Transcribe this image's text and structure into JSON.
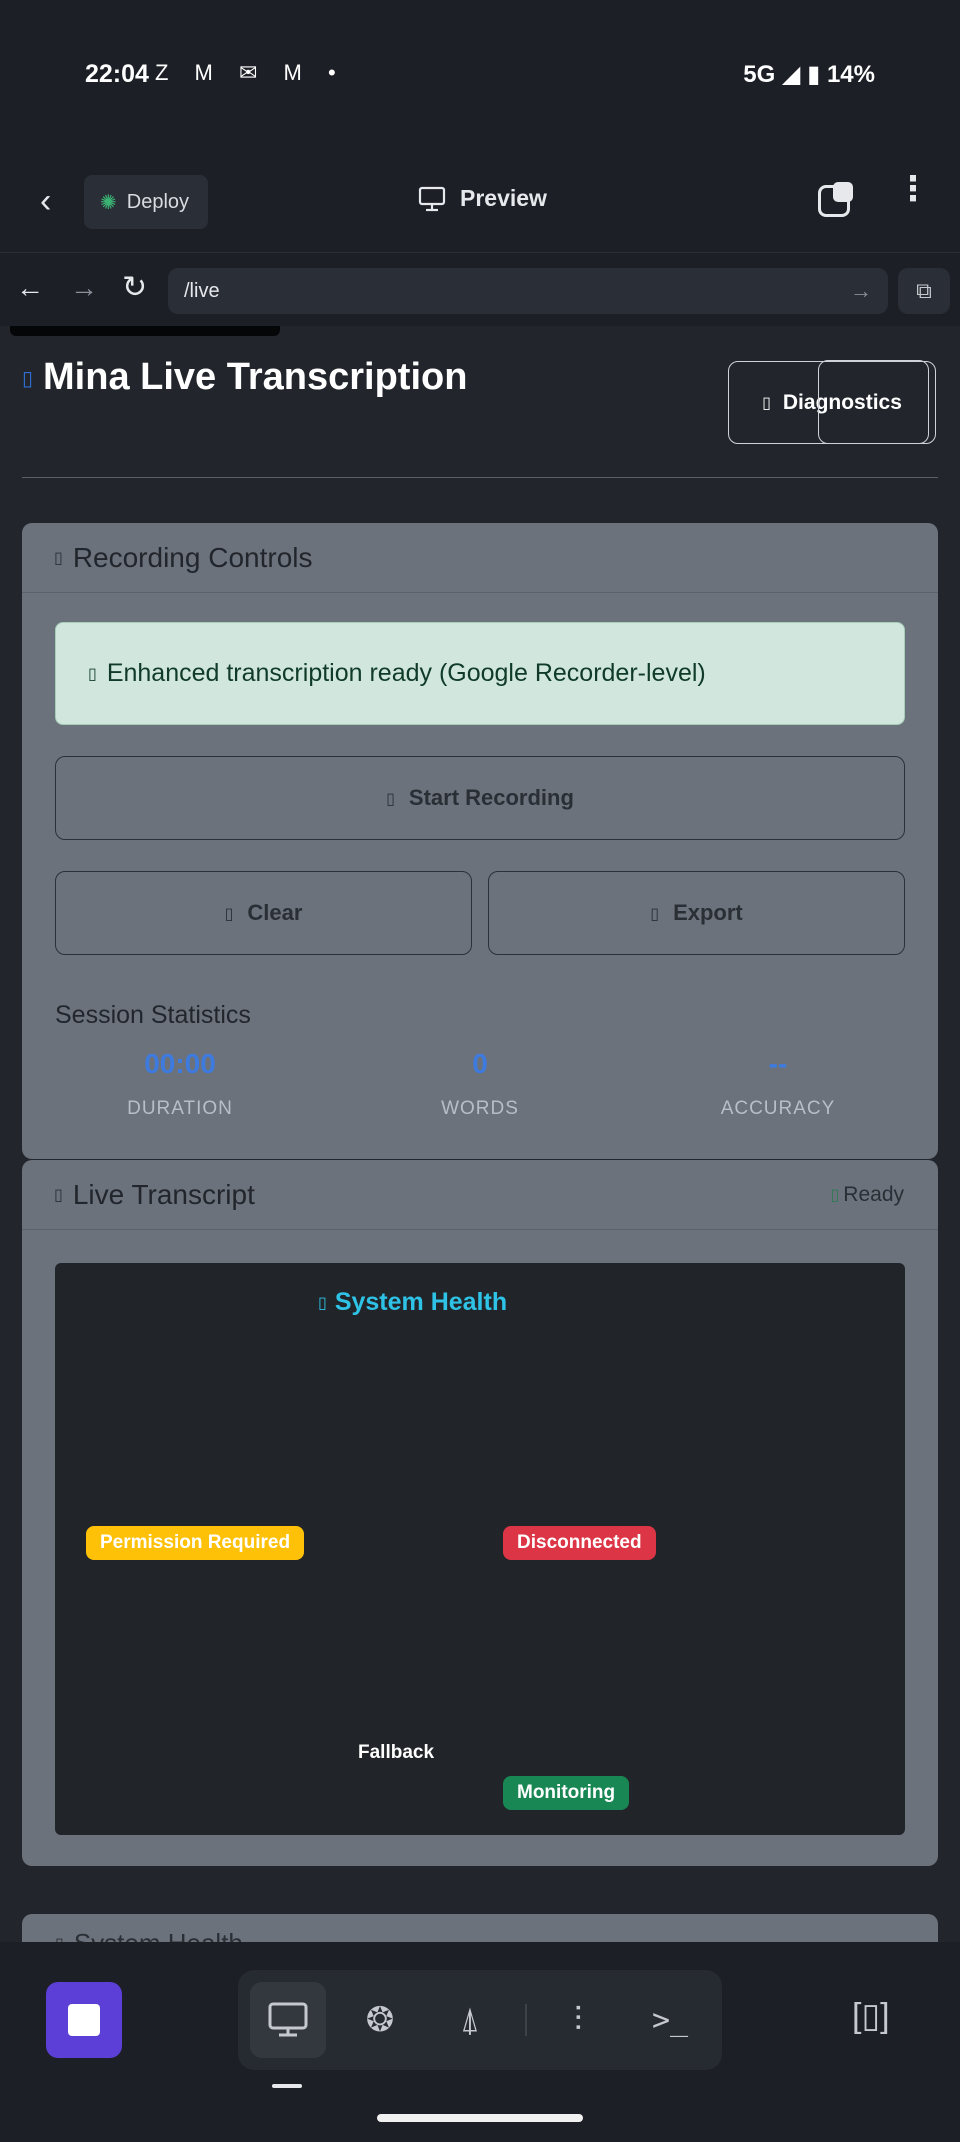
{
  "status_bar": {
    "time": "22:04",
    "notification_icons": "Z M ✉ M •",
    "network": "5G",
    "battery": "14%"
  },
  "app_header": {
    "deploy_label": "Deploy",
    "preview_label": "Preview"
  },
  "url_bar": {
    "url": "/live"
  },
  "page": {
    "title": "Mina Live Transcription",
    "diagnostics_label": "Diagnostics",
    "recording_card": {
      "title": "Recording Controls",
      "alert_text": "Enhanced transcription ready (Google Recorder-level)",
      "start_label": "Start Recording",
      "clear_label": "Clear",
      "export_label": "Export",
      "stats_title": "Session Statistics",
      "stats": [
        {
          "value": "00:00",
          "label": "DURATION"
        },
        {
          "value": "0",
          "label": "WORDS"
        },
        {
          "value": "--",
          "label": "ACCURACY"
        }
      ]
    },
    "transcript_card": {
      "title": "Live Transcript",
      "status": "Ready",
      "health_title": "System Health",
      "badges": {
        "permission": "Permission Required",
        "connection": "Disconnected",
        "fallback": "Fallback",
        "monitoring": "Monitoring"
      }
    },
    "next_card_title": "System Health"
  },
  "colors": {
    "accent": "#3d7be0",
    "warning": "#ffc107",
    "danger": "#dc3545",
    "success": "#198754",
    "info": "#2ec3e6",
    "stop_button": "#5b3fd6"
  },
  "icons": {
    "glyph_placeholder": "▯"
  }
}
